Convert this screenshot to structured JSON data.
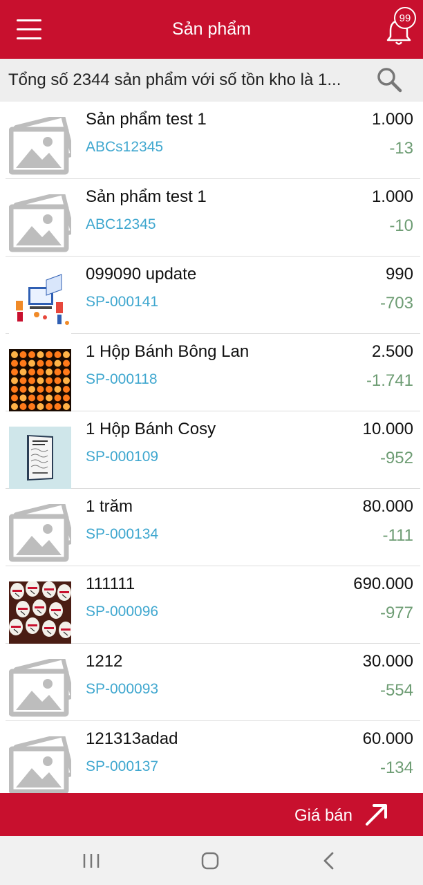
{
  "header": {
    "title": "Sản phẩm",
    "notification_count": "99"
  },
  "summary": {
    "text": "Tổng số 2344 sản phẩm với số tồn kho là 1..."
  },
  "products": [
    {
      "name": "Sản phẩm test 1",
      "code": "ABCs12345",
      "price": "1.000",
      "stock": "-13",
      "image": "placeholder-image"
    },
    {
      "name": "Sản phẩm test 1",
      "code": "ABC12345",
      "price": "1.000",
      "stock": "-10",
      "image": "placeholder-image"
    },
    {
      "name": "099090 update",
      "code": "SP-000141",
      "price": "990",
      "stock": "-703",
      "image": "illustration-image"
    },
    {
      "name": "1 Hộp Bánh Bông Lan",
      "code": "SP-000118",
      "price": "2.500",
      "stock": "-1.741",
      "image": "orange-lights-image"
    },
    {
      "name": "1 Hộp Bánh Cosy",
      "code": "SP-000109",
      "price": "10.000",
      "stock": "-952",
      "image": "book-image"
    },
    {
      "name": "1 trăm",
      "code": "SP-000134",
      "price": "80.000",
      "stock": "-111",
      "image": "placeholder-image"
    },
    {
      "name": "111111",
      "code": "SP-000096",
      "price": "690.000",
      "stock": "-977",
      "image": "lanterns-image"
    },
    {
      "name": "1212",
      "code": "SP-000093",
      "price": "30.000",
      "stock": "-554",
      "image": "placeholder-image"
    },
    {
      "name": "121313adad",
      "code": "SP-000137",
      "price": "60.000",
      "stock": "-134",
      "image": "placeholder-image"
    }
  ],
  "footer": {
    "price_label": "Giá bán"
  },
  "colors": {
    "brand_red": "#c8102e",
    "code_blue": "#3fa7cf",
    "stock_green": "#6d9c73"
  }
}
